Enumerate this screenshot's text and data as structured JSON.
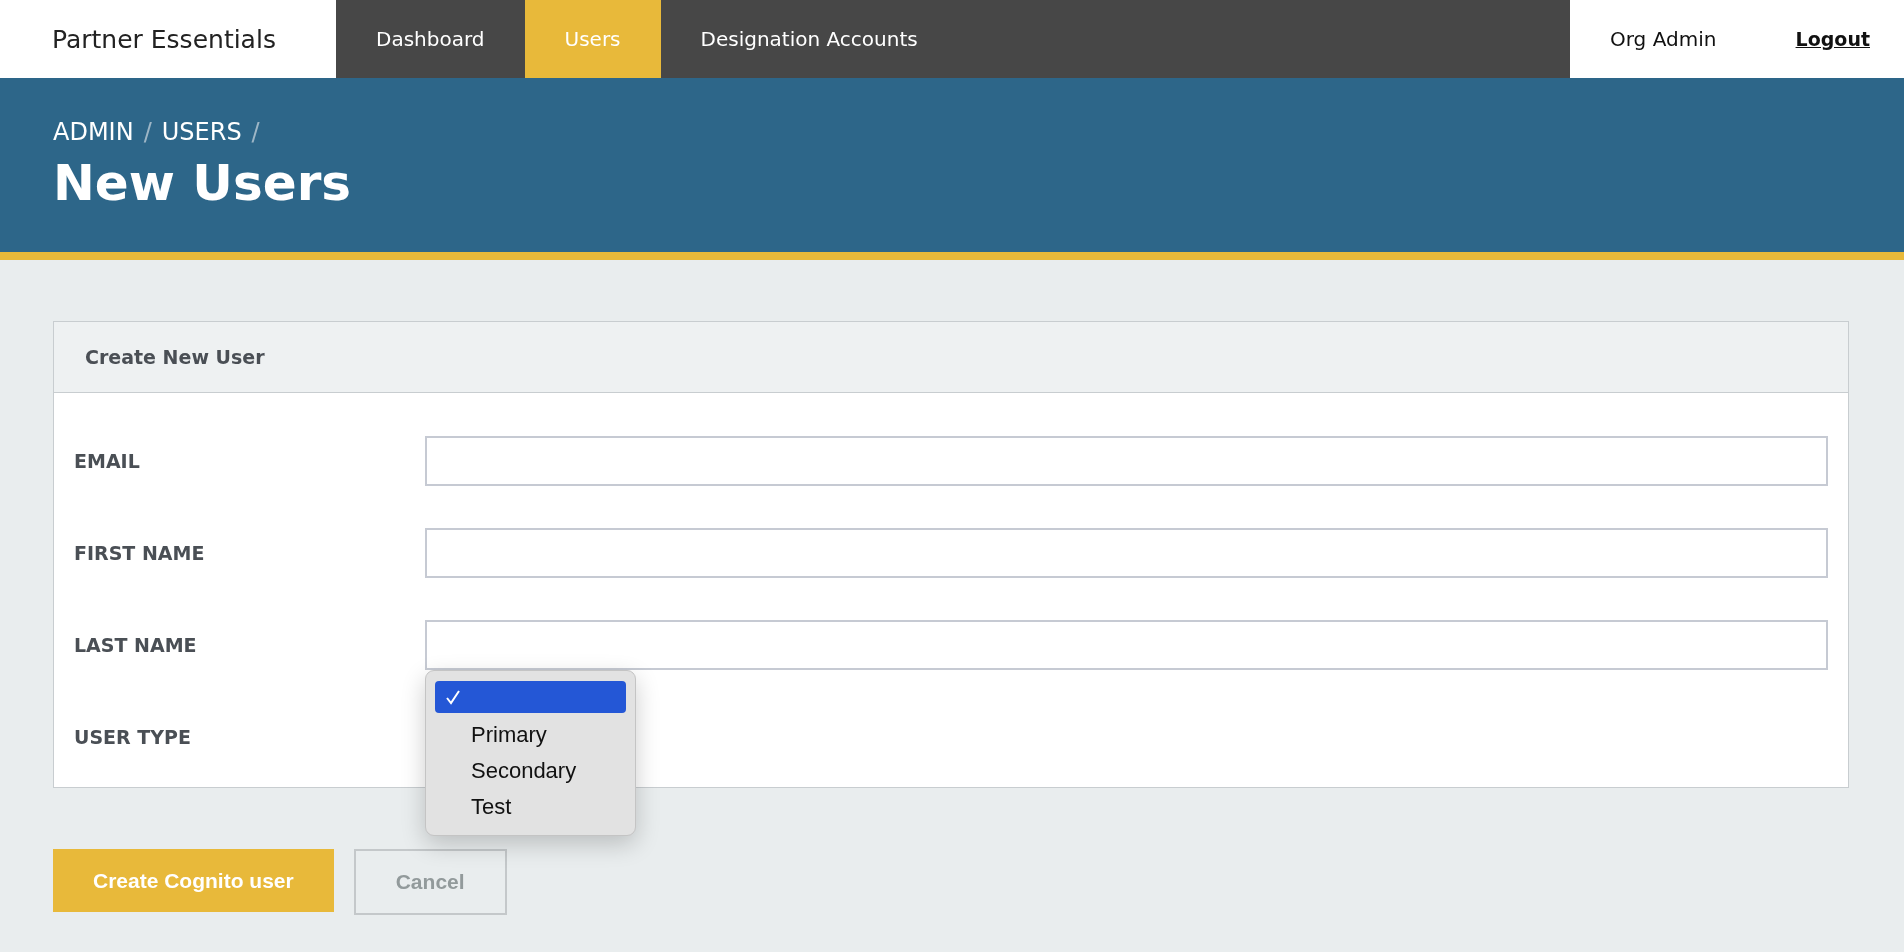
{
  "brand": "Partner Essentials",
  "nav": [
    {
      "label": "Dashboard",
      "selected": false
    },
    {
      "label": "Users",
      "selected": true
    },
    {
      "label": "Designation Accounts",
      "selected": false
    }
  ],
  "user": {
    "name": "Org Admin",
    "logout": "Logout"
  },
  "breadcrumb": [
    {
      "label": "ADMIN",
      "separator": "/"
    },
    {
      "label": "USERS",
      "separator": "/"
    }
  ],
  "title": "New Users",
  "card": {
    "title": "Create New User",
    "fields": [
      {
        "label": "EMAIL",
        "kind": "text"
      },
      {
        "label": "FIRST NAME",
        "kind": "text"
      },
      {
        "label": "LAST NAME",
        "kind": "text"
      },
      {
        "label": "USER TYPE",
        "kind": "select",
        "options": [
          {
            "selected": true
          },
          {
            "label": "Primary",
            "selected": false
          },
          {
            "label": "Secondary",
            "selected": false
          },
          {
            "label": "Test",
            "selected": false
          }
        ]
      }
    ]
  },
  "buttons": [
    {
      "label": "Create Cognito user",
      "kind": "primary"
    },
    {
      "label": "Cancel",
      "kind": "secondary"
    }
  ]
}
